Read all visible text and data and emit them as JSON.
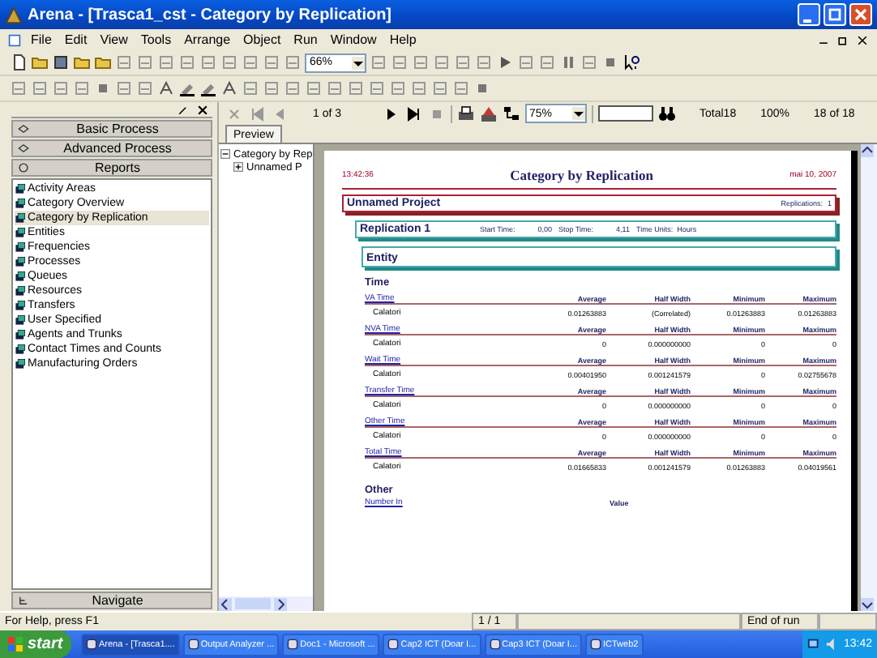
{
  "window": {
    "title": "Arena - [Trasca1_cst - Category by Replication]"
  },
  "menu": [
    "File",
    "Edit",
    "View",
    "Tools",
    "Arrange",
    "Object",
    "Run",
    "Window",
    "Help"
  ],
  "toolbar": {
    "zoom": "66%"
  },
  "panel": {
    "bars": [
      {
        "label": "Basic Process",
        "expanded": false
      },
      {
        "label": "Advanced Process",
        "expanded": false
      },
      {
        "label": "Reports",
        "expanded": true
      }
    ],
    "items": [
      {
        "label": "Activity Areas",
        "selected": false
      },
      {
        "label": "Category Overview",
        "selected": false
      },
      {
        "label": "Category by Replication",
        "selected": true
      },
      {
        "label": "Entities",
        "selected": false
      },
      {
        "label": "Frequencies",
        "selected": false
      },
      {
        "label": "Processes",
        "selected": false
      },
      {
        "label": "Queues",
        "selected": false
      },
      {
        "label": "Resources",
        "selected": false
      },
      {
        "label": "Transfers",
        "selected": false
      },
      {
        "label": "User Specified",
        "selected": false
      },
      {
        "label": "Agents and Trunks",
        "selected": false
      },
      {
        "label": "Contact Times and Counts",
        "selected": false
      },
      {
        "label": "Manufacturing Orders",
        "selected": false
      }
    ],
    "bottom_bar": "Navigate"
  },
  "report_toolbar": {
    "page": "1 of 3",
    "zoom": "75%",
    "total": "Total18",
    "percent": "100%",
    "count": "18 of 18"
  },
  "tab": "Preview",
  "tree": [
    {
      "label": "Category by Rep",
      "expanded": true,
      "children": [
        {
          "label": "Unnamed P",
          "expanded": false
        }
      ]
    }
  ],
  "report": {
    "time": "13:42:36",
    "title": "Category by Replication",
    "date": "mai 10, 2007",
    "project": "Unnamed Project",
    "replications_label": "Replications:",
    "replications": "1",
    "replication": "Replication 1",
    "start_label": "Start Time:",
    "start": "0,00",
    "stop_label": "Stop Time:",
    "stop": "4,11",
    "units": "Time Units:  Hours",
    "section": "Entity",
    "subsection": "Time",
    "groups": [
      {
        "title": "VA Time",
        "headers": [
          "Average",
          "Half Width",
          "Minimum",
          "Maximum"
        ],
        "row": {
          "name": "Calatori",
          "values": [
            "0.01263883",
            "(Correlated)",
            "0.01263883",
            "0.01263883"
          ]
        }
      },
      {
        "title": "NVA Time",
        "headers": [
          "Average",
          "Half Width",
          "Minimum",
          "Maximum"
        ],
        "row": {
          "name": "Calatori",
          "values": [
            "0",
            "0.000000000",
            "0",
            "0"
          ]
        }
      },
      {
        "title": "Wait Time",
        "headers": [
          "Average",
          "Half Width",
          "Minimum",
          "Maximum"
        ],
        "row": {
          "name": "Calatori",
          "values": [
            "0.00401950",
            "0.001241579",
            "0",
            "0.02755678"
          ]
        }
      },
      {
        "title": "Transfer Time",
        "headers": [
          "Average",
          "Half Width",
          "Minimum",
          "Maximum"
        ],
        "row": {
          "name": "Calatori",
          "values": [
            "0",
            "0.000000000",
            "0",
            "0"
          ]
        }
      },
      {
        "title": "Other Time",
        "headers": [
          "Average",
          "Half Width",
          "Minimum",
          "Maximum"
        ],
        "row": {
          "name": "Calatori",
          "values": [
            "0",
            "0.000000000",
            "0",
            "0"
          ]
        }
      },
      {
        "title": "Total Time",
        "headers": [
          "Average",
          "Half Width",
          "Minimum",
          "Maximum"
        ],
        "row": {
          "name": "Calatori",
          "values": [
            "0.01665833",
            "0.001241579",
            "0.01263883",
            "0.04019561"
          ]
        }
      }
    ],
    "other": "Other",
    "other_headers": [
      "Number In",
      "Value"
    ]
  },
  "status_bar": {
    "help": "For Help, press F1",
    "page": "1 / 1",
    "state": "End of run"
  },
  "taskbar": {
    "start": "start",
    "tasks": [
      {
        "label": "Arena - [Trasca1....",
        "selected": true
      },
      {
        "label": "Output Analyzer ...",
        "selected": false
      },
      {
        "label": "Doc1 - Microsoft ...",
        "selected": false
      },
      {
        "label": "Cap2 ICT (Doar I...",
        "selected": false
      },
      {
        "label": "Cap3 ICT (Doar I...",
        "selected": false
      },
      {
        "label": "ICTweb2",
        "selected": false
      }
    ],
    "clock": "13:42"
  }
}
